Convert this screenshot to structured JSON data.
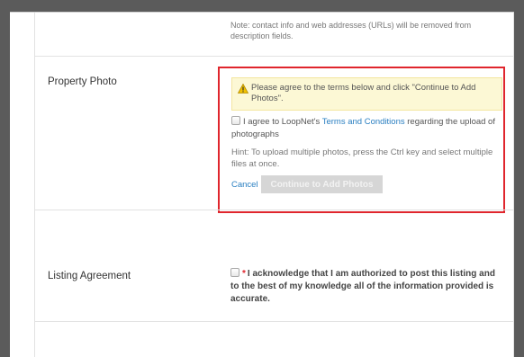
{
  "description_note": "Note: contact info and web addresses (URLs) will be removed from description fields.",
  "property_photo": {
    "label": "Property Photo",
    "warning": "Please agree to the terms below and click \"Continue to Add Photos\".",
    "agree_prefix": "I agree to LoopNet's ",
    "terms_link": "Terms and Conditions",
    "agree_suffix": " regarding the upload of photographs",
    "hint": "Hint: To upload multiple photos, press the Ctrl key and select multiple files at once.",
    "cancel": "Cancel",
    "continue": "Continue to Add Photos"
  },
  "listing_agreement": {
    "label": "Listing Agreement",
    "required_mark": "*",
    "text": "I acknowledge that I am authorized to post this listing and to the best of my knowledge all of the information provided is accurate."
  },
  "colors": {
    "highlight": "#e0262d",
    "link": "#2a7fc1",
    "warning_bg": "#fcf8d5"
  }
}
